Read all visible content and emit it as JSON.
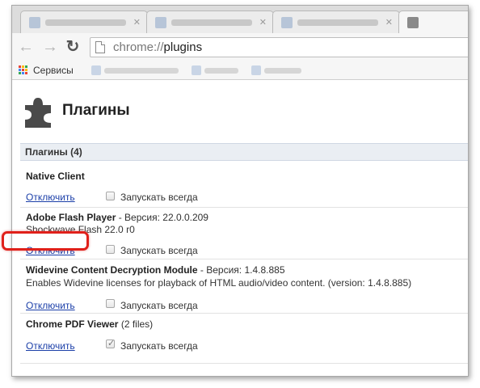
{
  "browser": {
    "url_scheme": "chrome://",
    "url_path": "plugins"
  },
  "bookmarks_bar": {
    "apps_label": "Сервисы"
  },
  "page": {
    "title": "Плагины",
    "section_header": "Плагины (4)"
  },
  "plugins": [
    {
      "name": "Native Client",
      "version_label": "",
      "version": "",
      "desc": "",
      "disable_label": "Отключить",
      "always_run_label": "Запускать всегда",
      "always_run_checked": false
    },
    {
      "name": "Adobe Flash Player",
      "version_label": " - Версия: ",
      "version": "22.0.0.209",
      "desc": "Shockwave Flash 22.0 r0",
      "disable_label": "Отключить",
      "always_run_label": "Запускать всегда",
      "always_run_checked": false
    },
    {
      "name": "Widevine Content Decryption Module",
      "version_label": " - Версия: ",
      "version": "1.4.8.885",
      "desc": "Enables Widevine licenses for playback of HTML audio/video content. (version: 1.4.8.885)",
      "disable_label": "Отключить",
      "always_run_label": "Запускать всегда",
      "always_run_checked": false
    },
    {
      "name": "Chrome PDF Viewer",
      "version_label": " (2 files)",
      "version": "",
      "desc": "",
      "disable_label": "Отключить",
      "always_run_label": "Запускать всегда",
      "always_run_checked": true
    }
  ],
  "colors": {
    "link": "#1a3ea8",
    "section_bg": "#eaeef3",
    "highlight": "#e0201a"
  }
}
